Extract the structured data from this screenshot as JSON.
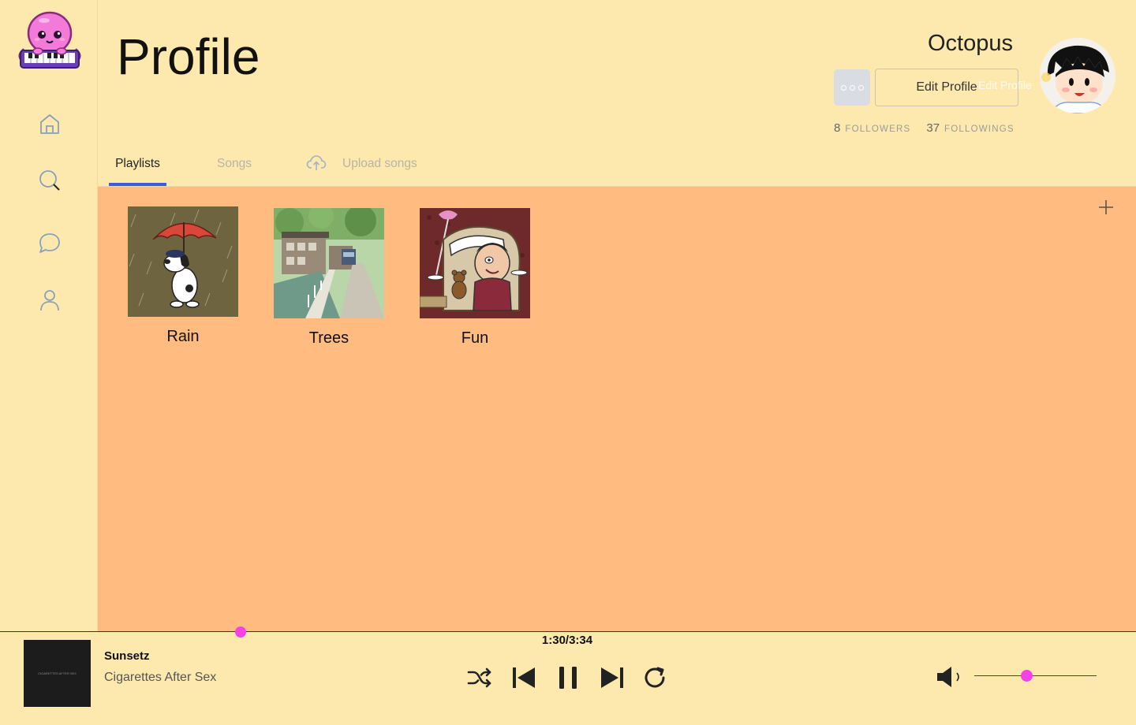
{
  "app": {
    "accent_color": "#3b5bdb",
    "highlight_color": "#f542e8",
    "background_color": "#fde9ae",
    "content_color": "#ffbb80"
  },
  "sidebar": {
    "logo": "octopus-piano-logo",
    "items": [
      {
        "name": "home",
        "icon": "home-icon"
      },
      {
        "name": "search",
        "icon": "search-icon"
      },
      {
        "name": "messages",
        "icon": "chat-bubble-icon"
      },
      {
        "name": "profile",
        "icon": "user-icon"
      }
    ]
  },
  "header": {
    "title": "Profile",
    "username": "Octopus",
    "edit_label": "Edit Profile",
    "edit_ghost_label": "Edit Profile",
    "followers_count": "8",
    "followers_label": "FOLLOWERS",
    "followings_count": "37",
    "followings_label": "FOLLOWINGS"
  },
  "tabs": [
    {
      "label": "Playlists",
      "active": true
    },
    {
      "label": "Songs",
      "active": false
    },
    {
      "label": "Upload songs",
      "active": false,
      "icon": "cloud-upload-icon"
    }
  ],
  "playlists": [
    {
      "name": "Rain"
    },
    {
      "name": "Trees"
    },
    {
      "name": "Fun"
    }
  ],
  "player": {
    "time": "1:30/3:34",
    "progress": 0.21,
    "song_title": "Sunsetz",
    "artist": "Cigarettes After Sex",
    "album_caption": "CIGARETTES AFTER SEX",
    "volume": 0.43,
    "controls": [
      "shuffle-icon",
      "previous-icon",
      "pause-icon",
      "next-icon",
      "repeat-icon"
    ]
  }
}
